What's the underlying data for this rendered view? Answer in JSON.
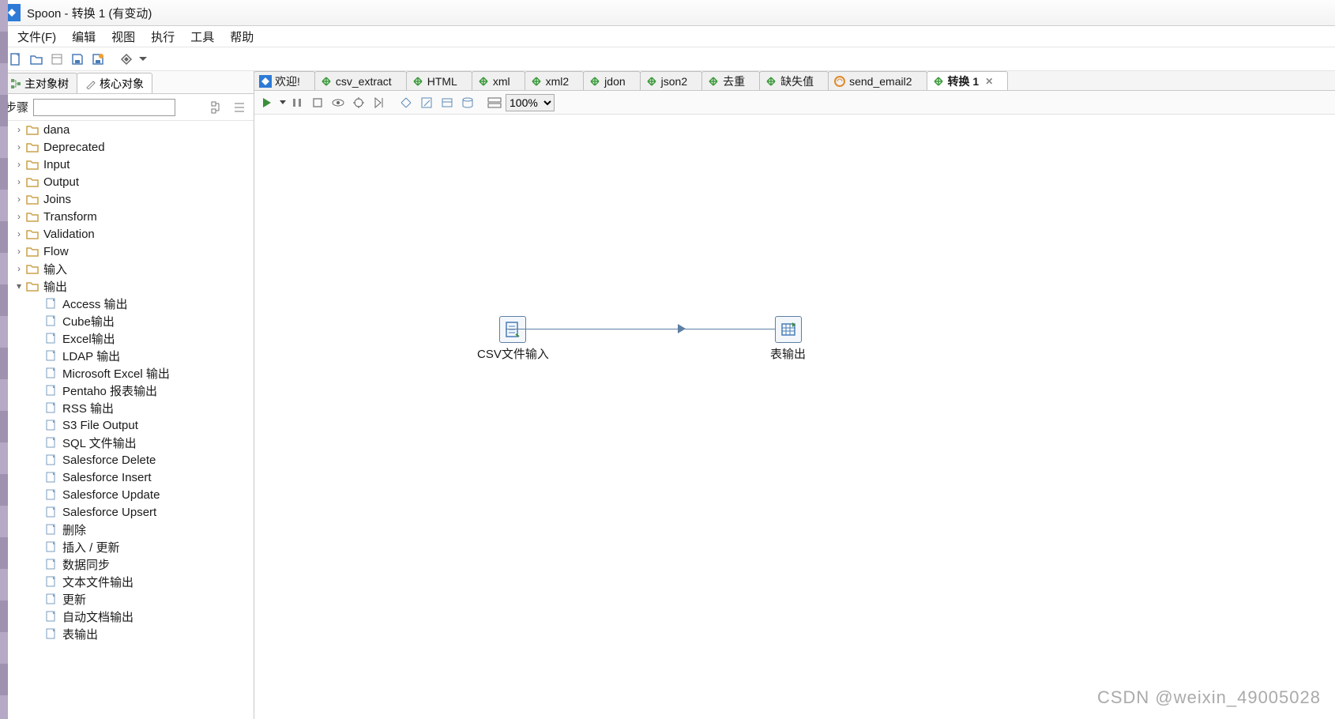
{
  "app": {
    "title": "Spoon - 转换 1 (有变动)"
  },
  "menu": {
    "file": "文件(F)",
    "edit": "编辑",
    "view": "视图",
    "run": "执行",
    "tools": "工具",
    "help": "帮助"
  },
  "left_tabs": {
    "tree": "主对象树",
    "core": "核心对象"
  },
  "search": {
    "label": "步骤",
    "value": ""
  },
  "categories": [
    {
      "name": "dana",
      "open": false
    },
    {
      "name": "Deprecated",
      "open": false
    },
    {
      "name": "Input",
      "open": false
    },
    {
      "name": "Output",
      "open": false
    },
    {
      "name": "Joins",
      "open": false
    },
    {
      "name": "Transform",
      "open": false
    },
    {
      "name": "Validation",
      "open": false
    },
    {
      "name": "Flow",
      "open": false
    },
    {
      "name": "输入",
      "open": false
    },
    {
      "name": "输出",
      "open": true
    }
  ],
  "output_children": [
    "Access 输出",
    "Cube输出",
    "Excel输出",
    "LDAP 输出",
    "Microsoft Excel 输出",
    "Pentaho 报表输出",
    "RSS 输出",
    "S3 File Output",
    "SQL 文件输出",
    "Salesforce Delete",
    "Salesforce Insert",
    "Salesforce Update",
    "Salesforce Upsert",
    "删除",
    "插入 / 更新",
    "数据同步",
    "文本文件输出",
    "更新",
    "自动文档输出",
    "表输出"
  ],
  "doc_tabs": [
    {
      "label": "欢迎!",
      "icon": "welcome"
    },
    {
      "label": "csv_extract",
      "icon": "ktr"
    },
    {
      "label": "HTML",
      "icon": "ktr"
    },
    {
      "label": "xml",
      "icon": "ktr"
    },
    {
      "label": "xml2",
      "icon": "ktr"
    },
    {
      "label": "jdon",
      "icon": "ktr"
    },
    {
      "label": "json2",
      "icon": "ktr"
    },
    {
      "label": "去重",
      "icon": "ktr"
    },
    {
      "label": "缺失值",
      "icon": "ktr"
    },
    {
      "label": "send_email2",
      "icon": "kjb"
    },
    {
      "label": "转换 1",
      "icon": "ktr",
      "active": true,
      "closable": true
    }
  ],
  "zoom": "100%",
  "canvas": {
    "node1": "CSV文件输入",
    "node2": "表输出"
  },
  "watermark": "CSDN @weixin_49005028"
}
